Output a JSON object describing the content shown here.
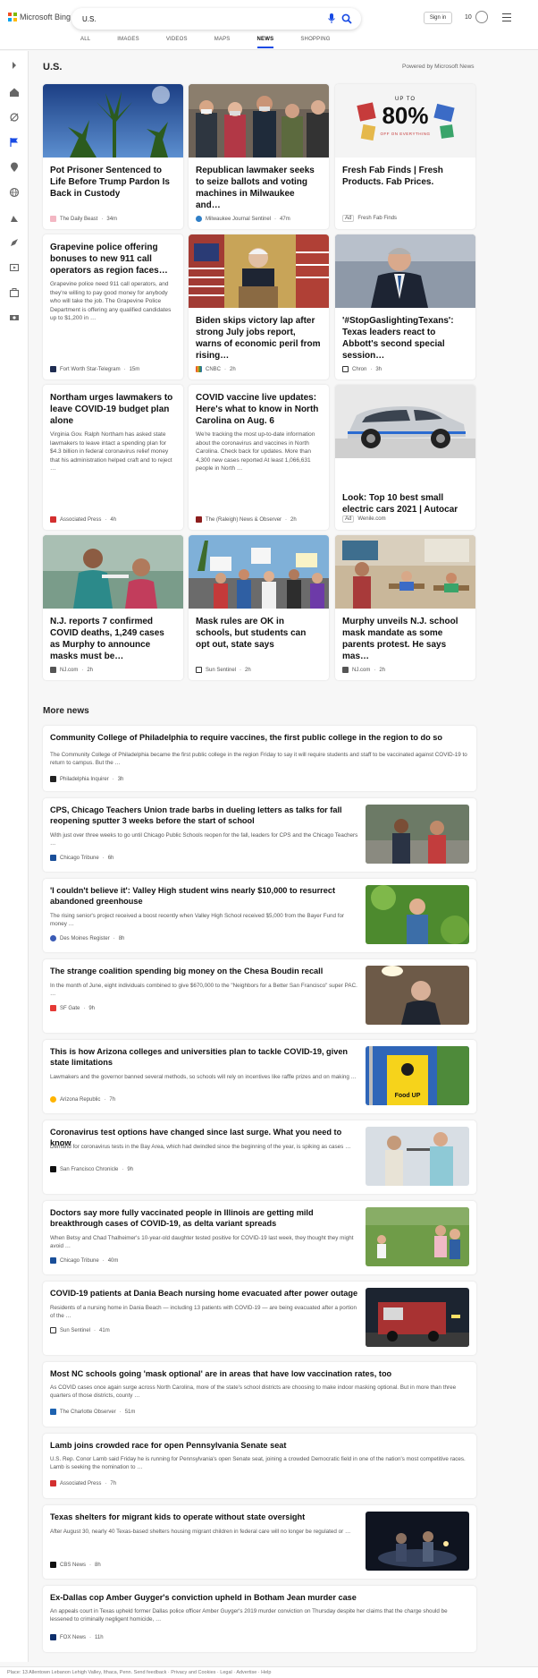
{
  "header": {
    "logo_text": "Microsoft Bing",
    "search_value": "U.S.",
    "signin_label": "Sign in",
    "rewards_count": "10",
    "tabs": [
      {
        "label": "ALL"
      },
      {
        "label": "IMAGES"
      },
      {
        "label": "VIDEOS"
      },
      {
        "label": "MAPS"
      },
      {
        "label": "NEWS",
        "active": true
      },
      {
        "label": "SHOPPING"
      }
    ]
  },
  "sidebar": {
    "icons": [
      "expand-icon",
      "home-icon",
      "sports-icon",
      "flag-icon",
      "location-icon",
      "globe-icon",
      "science-icon",
      "rocket-icon",
      "entertainment-icon",
      "briefcase-icon",
      "money-icon"
    ]
  },
  "top": {
    "title": "U.S.",
    "powered_by": "Powered by Microsoft News"
  },
  "cards": [
    {
      "title": "Pot Prisoner Sentenced to Life Before Trump Pardon Is Back in Custody",
      "snippet": "",
      "source": "The Daily Beast",
      "time": "34m",
      "ad": false
    },
    {
      "title": "Republican lawmaker seeks to seize ballots and voting machines in Milwaukee and…",
      "snippet": "",
      "source": "Milwaukee Journal Sentinel",
      "time": "47m",
      "ad": false
    },
    {
      "title": "Fresh Fab Finds | Fresh Products. Fab Prices.",
      "snippet": "",
      "source": "Fresh Fab Finds",
      "time": "",
      "ad": true,
      "ad_label": "Ad",
      "promo_top": "UP TO",
      "promo_big": "80%",
      "promo_bottom": "OFF ON EVERYTHING"
    },
    {
      "title": "Grapevine police offering bonuses to new 911 call operators as region faces…",
      "snippet": "Grapevine police need 911 call operators, and they're willing to pay good money for anybody who will take the job. The Grapevine Police Department is offering any qualified candidates up to $1,200 in …",
      "source": "Fort Worth Star-Telegram",
      "time": "15m",
      "ad": false
    },
    {
      "title": "Biden skips victory lap after strong July jobs report, warns of economic peril from rising…",
      "snippet": "",
      "source": "CNBC",
      "time": "2h",
      "ad": false
    },
    {
      "title": "'#StopGaslightingTexans': Texas leaders react to Abbott's second special session…",
      "snippet": "",
      "source": "Chron",
      "time": "3h",
      "ad": false
    },
    {
      "title": "Northam urges lawmakers to leave COVID-19 budget plan alone",
      "snippet": "Virginia Gov. Ralph Northam has asked state lawmakers to leave intact a spending plan for $4.3 billion in federal coronavirus relief money that his administration helped craft and to reject …",
      "source": "Associated Press",
      "time": "4h",
      "ad": false
    },
    {
      "title": "COVID vaccine live updates: Here's what to know in North Carolina on Aug. 6",
      "snippet": "We're tracking the most up-to-date information about the coronavirus and vaccines in North Carolina. Check back for updates. More than 4,300 new cases reported At least 1,066,631 people in North …",
      "source": "The (Raleigh) News & Observer",
      "time": "2h",
      "ad": false
    },
    {
      "title": "Look: Top 10 best small electric cars 2021 | Autocar",
      "snippet": "",
      "source": "Wenile.com",
      "time": "",
      "ad": true,
      "ad_label": "Ad"
    },
    {
      "title": "N.J. reports 7 confirmed COVID deaths, 1,249 cases as Murphy to announce masks must be…",
      "snippet": "",
      "source": "NJ.com",
      "time": "2h",
      "ad": false
    },
    {
      "title": "Mask rules are OK in schools, but students can opt out, state says",
      "snippet": "",
      "source": "Sun Sentinel",
      "time": "2h",
      "ad": false
    },
    {
      "title": "Murphy unveils N.J. school mask mandate as some parents protest. He says mas…",
      "snippet": "",
      "source": "NJ.com",
      "time": "2h",
      "ad": false
    }
  ],
  "more_news": {
    "title": "More news",
    "items": [
      {
        "title": "Community College of Philadelphia to require vaccines, the first public college in the region to do so",
        "snippet": "The Community College of Philadelphia became the first public college in the region Friday to say it will require students and staff to be vaccinated against COVID-19 to return to campus. But the …",
        "source": "Philadelphia Inquirer",
        "time": "3h",
        "thumb": false
      },
      {
        "title": "CPS, Chicago Teachers Union trade barbs in dueling letters as talks for fall reopening sputter 3 weeks before the start of school",
        "snippet": "With just over three weeks to go until Chicago Public Schools reopen for the fall, leaders for CPS and the Chicago Teachers …",
        "source": "Chicago Tribune",
        "time": "6h",
        "thumb": true
      },
      {
        "title": "'I couldn't believe it': Valley High student wins nearly $10,000 to resurrect abandoned greenhouse",
        "snippet": "The rising senior's project received a boost recently when Valley High School received $5,000 from the Bayer Fund for money …",
        "source": "Des Moines Register",
        "time": "8h",
        "thumb": true
      },
      {
        "title": "The strange coalition spending big money on the Chesa Boudin recall",
        "snippet": "In the month of June, eight individuals combined to give $670,000 to the \"Neighbors for a Better San Francisco\" super PAC. …",
        "source": "SF Gate",
        "time": "9h",
        "thumb": true
      },
      {
        "title": "This is how Arizona colleges and universities plan to tackle COVID-19, given state limitations",
        "snippet": "Lawmakers and the governor banned several methods, so schools will rely on incentives like raffle prizes and on making …",
        "source": "Arizona Republic",
        "time": "7h",
        "thumb": true,
        "thumb_text": "Food UP"
      },
      {
        "title": "Coronavirus test options have changed since last surge. What you need to know",
        "snippet": "Demand for coronavirus tests in the Bay Area, which had dwindled since the beginning of the year, is spiking as cases …",
        "source": "San Francisco Chronicle",
        "time": "9h",
        "thumb": true
      },
      {
        "title": "Doctors say more fully vaccinated people in Illinois are getting mild breakthrough cases of COVID-19, as delta variant spreads",
        "snippet": "When Betsy and Chad Thalheimer's 10-year-old daughter tested positive for COVID-19 last week, they thought they might avoid …",
        "source": "Chicago Tribune",
        "time": "40m",
        "thumb": true
      },
      {
        "title": "COVID-19 patients at Dania Beach nursing home evacuated after power outage",
        "snippet": "Residents of a nursing home in Dania Beach — including 13 patients with COVID-19 — are being evacuated after a portion of the …",
        "source": "Sun Sentinel",
        "time": "41m",
        "thumb": true
      },
      {
        "title": "Most NC schools going 'mask optional' are in areas that have low vaccination rates, too",
        "snippet": "As COVID cases once again surge across North Carolina, more of the state's school districts are choosing to make indoor masking optional. But in more than three quarters of those districts, county …",
        "source": "The Charlotte Observer",
        "time": "51m",
        "thumb": false
      },
      {
        "title": "Lamb joins crowded race for open Pennsylvania Senate seat",
        "snippet": "U.S. Rep. Conor Lamb said Friday he is running for Pennsylvania's open Senate seat, joining a crowded Democratic field in one of the nation's most competitive races. Lamb is seeking the nomination to …",
        "source": "Associated Press",
        "time": "7h",
        "thumb": false
      },
      {
        "title": "Texas shelters for migrant kids to operate without state oversight",
        "snippet": "After August 30, nearly 40 Texas-based shelters housing migrant children in federal care will no longer be regulated or …",
        "source": "CBS News",
        "time": "8h",
        "thumb": true
      },
      {
        "title": "Ex-Dallas cop Amber Guyger's conviction upheld in Botham Jean murder case",
        "snippet": "An appeals court in Texas upheld former Dallas police officer Amber Guyger's 2019 murder conviction on Thursday despite her claims that the charge should be lessened to criminally negligent homicide, …",
        "source": "FOX News",
        "time": "11h",
        "thumb": false
      }
    ]
  },
  "footer": {
    "text": "Place: 13 Allentown Lebanon Lehigh Valley, Ithaca, Penn. Send feedback · Privacy and Cookies · Legal · Advertise · Help"
  },
  "colors": {
    "accent": "#174ae4",
    "background": "#f7f7f7",
    "card": "#ffffff"
  }
}
